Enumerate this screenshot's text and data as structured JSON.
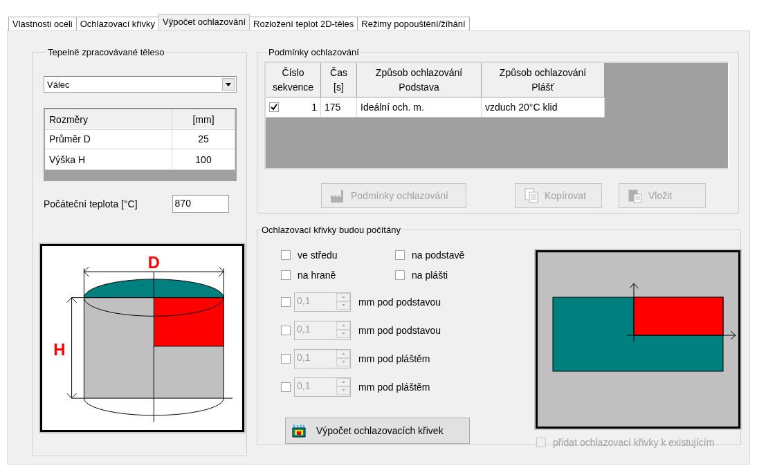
{
  "tabs": [
    {
      "label": "Vlastnosti oceli",
      "selected": false
    },
    {
      "label": "Ochlazovací křivky",
      "selected": false
    },
    {
      "label": "Výpočet ochlazování",
      "selected": true
    },
    {
      "label": "Rozložení teplot 2D-těles",
      "selected": false
    },
    {
      "label": "Režimy popouštění/žíhání",
      "selected": false
    }
  ],
  "body": {
    "title": "Tepelně zpracovávané těleso",
    "shape": "Válec",
    "dimensions": {
      "columns": [
        "Rozměry",
        "[mm]"
      ],
      "rows": [
        [
          "Průměr D",
          "25"
        ],
        [
          "Výška H",
          "100"
        ]
      ]
    },
    "initial_temp": {
      "label": "Počáteční teplota [°C]",
      "value": "870"
    },
    "diagram": {
      "width_label": "D",
      "height_label": "H"
    }
  },
  "conditions": {
    "title": "Podmínky ochlazování",
    "columns": [
      "Číslo\nsekvence",
      "Čas\n[s]",
      "Způsob ochlazování\nPodstava",
      "Způsob ochlazování\nPlášť"
    ],
    "rows": [
      {
        "checked": true,
        "sequence": "1",
        "time": "175",
        "base": "Ideální och. m.",
        "mantle": "vzduch 20°C klid"
      }
    ],
    "buttons": [
      {
        "label": "Podmínky ochlazování",
        "kind": "factory",
        "disabled": true
      },
      {
        "label": "Kopírovat",
        "kind": "copy",
        "disabled": true
      },
      {
        "label": "Vložit",
        "kind": "paste",
        "disabled": true
      }
    ]
  },
  "curves": {
    "title": "Ochlazovací křivky budou počítány",
    "points": [
      {
        "label": "ve středu",
        "checked": false
      },
      {
        "label": "na podstavě",
        "checked": false
      },
      {
        "label": "na hraně",
        "checked": false
      },
      {
        "label": "na plášti",
        "checked": false
      }
    ],
    "depths": [
      {
        "checked": false,
        "value": "0,1",
        "disabled": true,
        "label": "mm pod podstavou"
      },
      {
        "checked": false,
        "value": "0,1",
        "disabled": true,
        "label": "mm pod podstavou"
      },
      {
        "checked": false,
        "value": "0,1",
        "disabled": true,
        "label": "mm pod pláštěm"
      },
      {
        "checked": false,
        "value": "0,1",
        "disabled": true,
        "label": "mm pod pláštěm"
      }
    ],
    "compute_button": "Výpočet ochlazovacích křivek",
    "append": {
      "label": "přidat ochlazovací křivky k existujícím",
      "checked": false,
      "disabled": true
    }
  }
}
